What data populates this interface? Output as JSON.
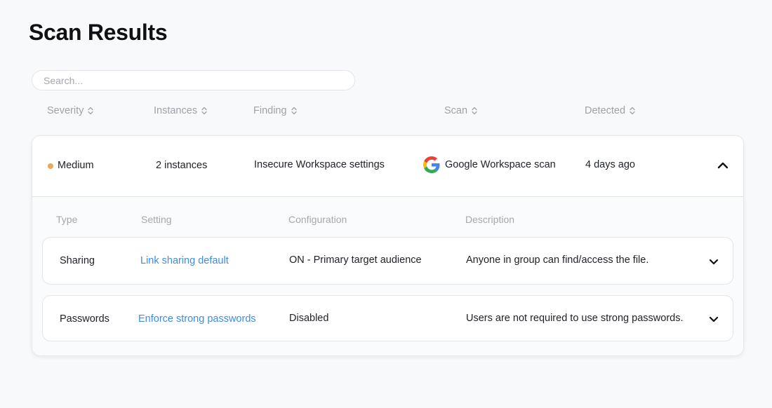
{
  "page": {
    "title": "Scan Results"
  },
  "search": {
    "placeholder": "Search...",
    "value": ""
  },
  "columns": {
    "severity": "Severity",
    "instances": "Instances",
    "finding": "Finding",
    "scan": "Scan",
    "detected": "Detected"
  },
  "finding": {
    "severity": "Medium",
    "severity_color": "#f2a65a",
    "instances": "2 instances",
    "finding": "Insecure Workspace settings",
    "scan_icon": "google-icon",
    "scan": "Google Workspace scan",
    "detected": "4 days ago",
    "expanded": true
  },
  "detail": {
    "columns": {
      "type": "Type",
      "setting": "Setting",
      "configuration": "Configuration",
      "description": "Description"
    },
    "rows": [
      {
        "type": "Sharing",
        "setting": "Link sharing default",
        "configuration": "ON - Primary target audience",
        "description": "Anyone in group can find/access the file."
      },
      {
        "type": "Passwords",
        "setting": "Enforce strong passwords",
        "configuration": "Disabled",
        "description": "Users are not required to use strong passwords."
      }
    ]
  },
  "colors": {
    "link": "#3d8ce6",
    "background": "#f8f9fb"
  }
}
